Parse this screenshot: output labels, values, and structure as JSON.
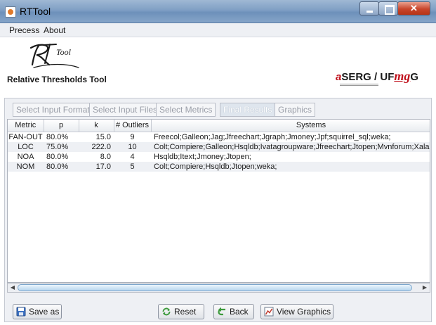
{
  "window": {
    "title": "RTTool"
  },
  "menu": {
    "items": [
      "Precess",
      "About"
    ]
  },
  "header": {
    "logo_text": "RTool",
    "subtitle": "Relative Thresholds Tool",
    "partner_logo_text": "aSERG / UFMG",
    "partner_logo_a": "a",
    "partner_logo_rest": "SERG / UF",
    "partner_logo_mg": "mg",
    "partner_logo_g": "G"
  },
  "tabs": [
    {
      "label": "Select Input Format",
      "active": false
    },
    {
      "label": "Select Input Files",
      "active": false
    },
    {
      "label": "Select Metrics",
      "active": false
    },
    {
      "label": "Final Results",
      "active": true
    },
    {
      "label": "Graphics",
      "active": false
    }
  ],
  "table": {
    "columns": [
      "Metric",
      "p",
      "k",
      "# Outliers",
      "Systems"
    ],
    "rows": [
      [
        "FAN-OUT",
        "80.0%",
        "15.0",
        "9",
        "Freecol;Galleon;Jag;Jfreechart;Jgraph;Jmoney;Jpf;squirrel_sql;weka;"
      ],
      [
        "LOC",
        "75.0%",
        "222.0",
        "10",
        "Colt;Compiere;Galleon;Hsqldb;Ivatagroupware;Jfreechart;Jtopen;Mvnforum;Xalan;weka;"
      ],
      [
        "NOA",
        "80.0%",
        "8.0",
        "4",
        "Hsqldb;Itext;Jmoney;Jtopen;"
      ],
      [
        "NOM",
        "80.0%",
        "17.0",
        "5",
        "Colt;Compiere;Hsqldb;Jtopen;weka;"
      ]
    ]
  },
  "buttons": {
    "save_as": "Save as",
    "reset": "Reset",
    "back": "Back",
    "view_graphics": "View Graphics"
  }
}
